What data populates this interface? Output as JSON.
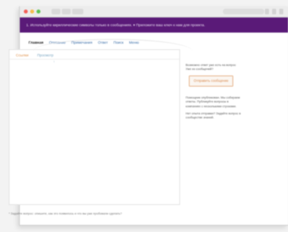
{
  "banner": {
    "text": "1. Используйте кириллические символы только в сообщениях. ▾ Приложите ваш ключ к нам для проекта."
  },
  "tabs": [
    {
      "label": "Главная"
    },
    {
      "label": "Описание"
    },
    {
      "label": "Примечания"
    },
    {
      "label": "Ответ"
    },
    {
      "label": "Поиск"
    },
    {
      "label": "Меню"
    }
  ],
  "editor": {
    "tabs": [
      {
        "label": "Ссылки"
      },
      {
        "label": "Просмотр"
      }
    ],
    "cursor_mark": "↑"
  },
  "sidebar": {
    "intro_line1": "Возможно ответ уже есть на вопрос",
    "intro_line2": "Уже из сообщений?",
    "button_label": "Отправить сообщение",
    "note1": "Помощник опубликован. Мы собираем ответы. Публикуйте вопросы в компаниях с несколькими строками.",
    "note2": "Нет опыта отправки? Задайте вопрос в сообществе знаний."
  },
  "footer": {
    "text": "* Задайте вопрос: опишите, как это появилось и что вы уже пробовали сделать?"
  },
  "colors": {
    "banner_bg": "#5a1a78",
    "accent": "#e0934d",
    "link": "#3b6ea8"
  }
}
